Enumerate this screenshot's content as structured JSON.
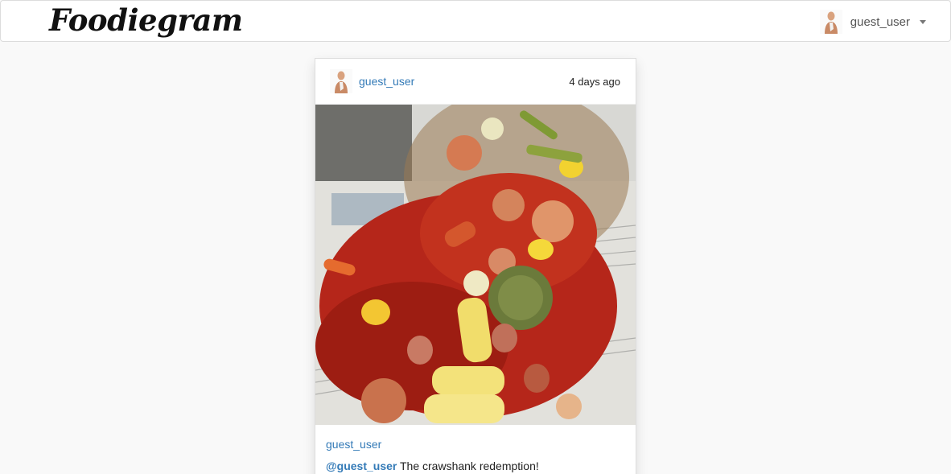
{
  "navbar": {
    "brand": "Foodiegram",
    "user": {
      "name": "guest_user",
      "avatar_icon": "avatar-icon"
    }
  },
  "post": {
    "author": "guest_user",
    "timestamp": "4 days ago",
    "photo_subject": "crawfish-boil-photo",
    "caption_user": "guest_user",
    "caption_mention": "@guest_user",
    "caption_text": " The crawshank redemption!"
  },
  "colors": {
    "link": "#337ab7",
    "background": "#f9f9f9",
    "navbar_border": "#dcdcdc"
  }
}
